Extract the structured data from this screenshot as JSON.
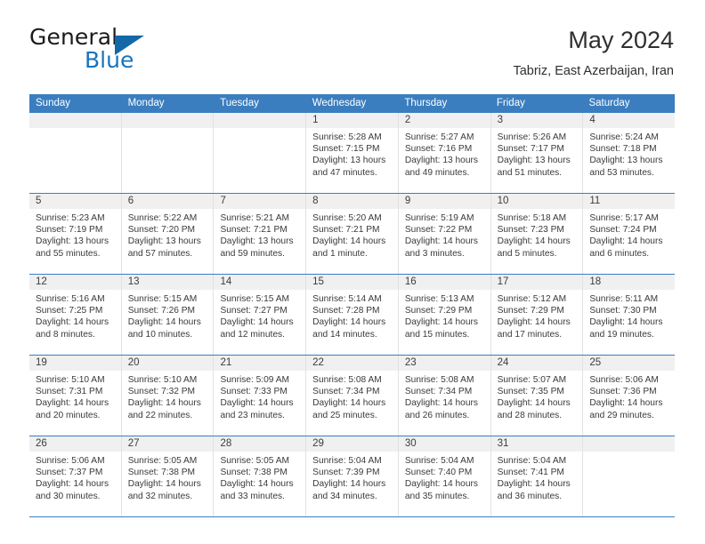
{
  "brand": {
    "name_top": "General",
    "name_bottom": "Blue",
    "accent_color": "#1874bd",
    "triangle_color": "#1368a8"
  },
  "header": {
    "title": "May 2024",
    "subtitle": "Tabriz, East Azerbaijan, Iran"
  },
  "theme": {
    "header_bar_color": "#3a7ebf",
    "day_band_color": "#f0f0f0",
    "row_separator_color": "#3a7ebf",
    "text_color": "#3a3a3a"
  },
  "weekdays": [
    "Sunday",
    "Monday",
    "Tuesday",
    "Wednesday",
    "Thursday",
    "Friday",
    "Saturday"
  ],
  "weeks": [
    [
      {
        "day": "",
        "empty": true,
        "lines": []
      },
      {
        "day": "",
        "empty": true,
        "lines": []
      },
      {
        "day": "",
        "empty": true,
        "lines": []
      },
      {
        "day": "1",
        "empty": false,
        "lines": [
          "Sunrise: 5:28 AM",
          "Sunset: 7:15 PM",
          "Daylight: 13 hours",
          "and 47 minutes."
        ]
      },
      {
        "day": "2",
        "empty": false,
        "lines": [
          "Sunrise: 5:27 AM",
          "Sunset: 7:16 PM",
          "Daylight: 13 hours",
          "and 49 minutes."
        ]
      },
      {
        "day": "3",
        "empty": false,
        "lines": [
          "Sunrise: 5:26 AM",
          "Sunset: 7:17 PM",
          "Daylight: 13 hours",
          "and 51 minutes."
        ]
      },
      {
        "day": "4",
        "empty": false,
        "lines": [
          "Sunrise: 5:24 AM",
          "Sunset: 7:18 PM",
          "Daylight: 13 hours",
          "and 53 minutes."
        ]
      }
    ],
    [
      {
        "day": "5",
        "empty": false,
        "lines": [
          "Sunrise: 5:23 AM",
          "Sunset: 7:19 PM",
          "Daylight: 13 hours",
          "and 55 minutes."
        ]
      },
      {
        "day": "6",
        "empty": false,
        "lines": [
          "Sunrise: 5:22 AM",
          "Sunset: 7:20 PM",
          "Daylight: 13 hours",
          "and 57 minutes."
        ]
      },
      {
        "day": "7",
        "empty": false,
        "lines": [
          "Sunrise: 5:21 AM",
          "Sunset: 7:21 PM",
          "Daylight: 13 hours",
          "and 59 minutes."
        ]
      },
      {
        "day": "8",
        "empty": false,
        "lines": [
          "Sunrise: 5:20 AM",
          "Sunset: 7:21 PM",
          "Daylight: 14 hours",
          "and 1 minute."
        ]
      },
      {
        "day": "9",
        "empty": false,
        "lines": [
          "Sunrise: 5:19 AM",
          "Sunset: 7:22 PM",
          "Daylight: 14 hours",
          "and 3 minutes."
        ]
      },
      {
        "day": "10",
        "empty": false,
        "lines": [
          "Sunrise: 5:18 AM",
          "Sunset: 7:23 PM",
          "Daylight: 14 hours",
          "and 5 minutes."
        ]
      },
      {
        "day": "11",
        "empty": false,
        "lines": [
          "Sunrise: 5:17 AM",
          "Sunset: 7:24 PM",
          "Daylight: 14 hours",
          "and 6 minutes."
        ]
      }
    ],
    [
      {
        "day": "12",
        "empty": false,
        "lines": [
          "Sunrise: 5:16 AM",
          "Sunset: 7:25 PM",
          "Daylight: 14 hours",
          "and 8 minutes."
        ]
      },
      {
        "day": "13",
        "empty": false,
        "lines": [
          "Sunrise: 5:15 AM",
          "Sunset: 7:26 PM",
          "Daylight: 14 hours",
          "and 10 minutes."
        ]
      },
      {
        "day": "14",
        "empty": false,
        "lines": [
          "Sunrise: 5:15 AM",
          "Sunset: 7:27 PM",
          "Daylight: 14 hours",
          "and 12 minutes."
        ]
      },
      {
        "day": "15",
        "empty": false,
        "lines": [
          "Sunrise: 5:14 AM",
          "Sunset: 7:28 PM",
          "Daylight: 14 hours",
          "and 14 minutes."
        ]
      },
      {
        "day": "16",
        "empty": false,
        "lines": [
          "Sunrise: 5:13 AM",
          "Sunset: 7:29 PM",
          "Daylight: 14 hours",
          "and 15 minutes."
        ]
      },
      {
        "day": "17",
        "empty": false,
        "lines": [
          "Sunrise: 5:12 AM",
          "Sunset: 7:29 PM",
          "Daylight: 14 hours",
          "and 17 minutes."
        ]
      },
      {
        "day": "18",
        "empty": false,
        "lines": [
          "Sunrise: 5:11 AM",
          "Sunset: 7:30 PM",
          "Daylight: 14 hours",
          "and 19 minutes."
        ]
      }
    ],
    [
      {
        "day": "19",
        "empty": false,
        "lines": [
          "Sunrise: 5:10 AM",
          "Sunset: 7:31 PM",
          "Daylight: 14 hours",
          "and 20 minutes."
        ]
      },
      {
        "day": "20",
        "empty": false,
        "lines": [
          "Sunrise: 5:10 AM",
          "Sunset: 7:32 PM",
          "Daylight: 14 hours",
          "and 22 minutes."
        ]
      },
      {
        "day": "21",
        "empty": false,
        "lines": [
          "Sunrise: 5:09 AM",
          "Sunset: 7:33 PM",
          "Daylight: 14 hours",
          "and 23 minutes."
        ]
      },
      {
        "day": "22",
        "empty": false,
        "lines": [
          "Sunrise: 5:08 AM",
          "Sunset: 7:34 PM",
          "Daylight: 14 hours",
          "and 25 minutes."
        ]
      },
      {
        "day": "23",
        "empty": false,
        "lines": [
          "Sunrise: 5:08 AM",
          "Sunset: 7:34 PM",
          "Daylight: 14 hours",
          "and 26 minutes."
        ]
      },
      {
        "day": "24",
        "empty": false,
        "lines": [
          "Sunrise: 5:07 AM",
          "Sunset: 7:35 PM",
          "Daylight: 14 hours",
          "and 28 minutes."
        ]
      },
      {
        "day": "25",
        "empty": false,
        "lines": [
          "Sunrise: 5:06 AM",
          "Sunset: 7:36 PM",
          "Daylight: 14 hours",
          "and 29 minutes."
        ]
      }
    ],
    [
      {
        "day": "26",
        "empty": false,
        "lines": [
          "Sunrise: 5:06 AM",
          "Sunset: 7:37 PM",
          "Daylight: 14 hours",
          "and 30 minutes."
        ]
      },
      {
        "day": "27",
        "empty": false,
        "lines": [
          "Sunrise: 5:05 AM",
          "Sunset: 7:38 PM",
          "Daylight: 14 hours",
          "and 32 minutes."
        ]
      },
      {
        "day": "28",
        "empty": false,
        "lines": [
          "Sunrise: 5:05 AM",
          "Sunset: 7:38 PM",
          "Daylight: 14 hours",
          "and 33 minutes."
        ]
      },
      {
        "day": "29",
        "empty": false,
        "lines": [
          "Sunrise: 5:04 AM",
          "Sunset: 7:39 PM",
          "Daylight: 14 hours",
          "and 34 minutes."
        ]
      },
      {
        "day": "30",
        "empty": false,
        "lines": [
          "Sunrise: 5:04 AM",
          "Sunset: 7:40 PM",
          "Daylight: 14 hours",
          "and 35 minutes."
        ]
      },
      {
        "day": "31",
        "empty": false,
        "lines": [
          "Sunrise: 5:04 AM",
          "Sunset: 7:41 PM",
          "Daylight: 14 hours",
          "and 36 minutes."
        ]
      },
      {
        "day": "",
        "empty": true,
        "lines": []
      }
    ]
  ]
}
